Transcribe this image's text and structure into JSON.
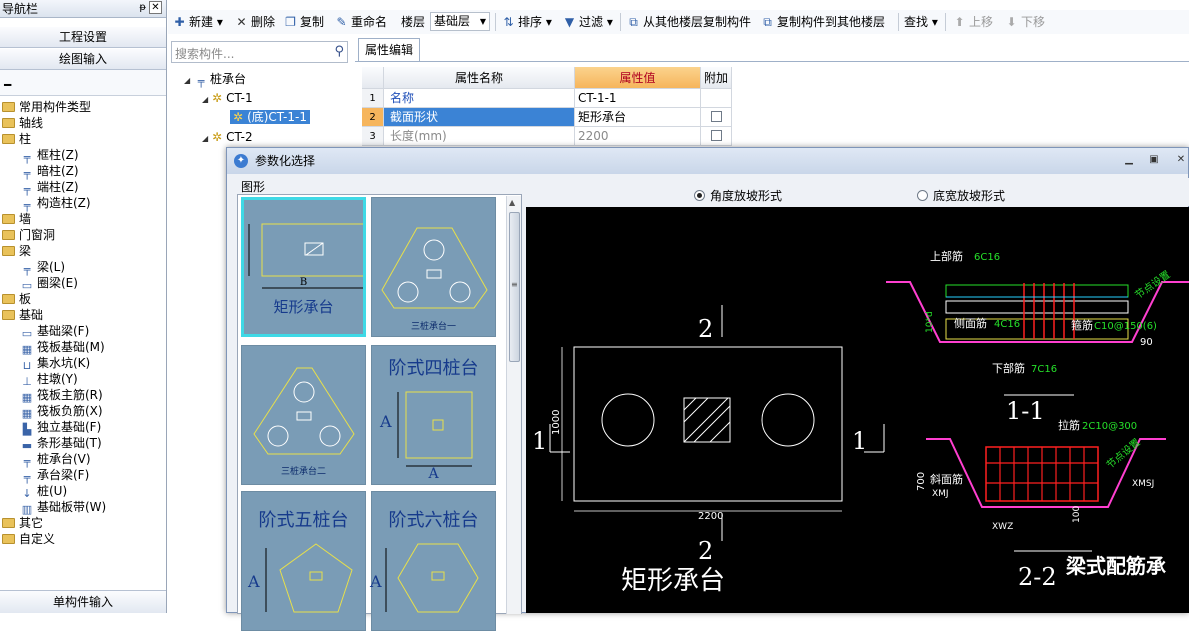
{
  "nav": {
    "title": "导航栏",
    "pin": "ᵽ",
    "close": "✕",
    "btn_settings": "工程设置",
    "btn_draw": "绘图输入",
    "bottom": "单构件输入",
    "groups": [
      {
        "label": "常用构件类型"
      },
      {
        "label": "轴线"
      },
      {
        "label": "柱"
      },
      {
        "label": "墙"
      },
      {
        "label": "门窗洞"
      },
      {
        "label": "梁"
      },
      {
        "label": "板"
      },
      {
        "label": "基础"
      },
      {
        "label": "其它"
      },
      {
        "label": "自定义"
      }
    ],
    "items": {
      "kz": "框柱(Z)",
      "az": "暗柱(Z)",
      "dz": "端柱(Z)",
      "gzz": "构造柱(Z)",
      "liang": "梁(L)",
      "ql": "圈梁(E)",
      "jcl": "基础梁(F)",
      "fbjc": "筏板基础(M)",
      "jsk": "集水坑(K)",
      "zd": "柱墩(Y)",
      "fbzj": "筏板主筋(R)",
      "fbfj": "筏板负筋(X)",
      "dljc": "独立基础(F)",
      "txjc": "条形基础(T)",
      "zct": "桩承台(V)",
      "ctl": "承台梁(F)",
      "zhuang": "桩(U)",
      "jcbd": "基础板带(W)"
    }
  },
  "toolbar": {
    "new": "新建",
    "delete": "删除",
    "copy": "复制",
    "rename": "重命名",
    "floor_label": "楼层",
    "floor_value": "基础层",
    "sort": "排序",
    "filter": "过滤",
    "copy_from": "从其他楼层复制构件",
    "copy_to": "复制构件到其他楼层",
    "find": "查找",
    "up": "上移",
    "down": "下移"
  },
  "search": {
    "placeholder": "搜索构件..."
  },
  "tree": {
    "root": "桩承台",
    "ct1": "CT-1",
    "ct11": "(底)CT-1-1",
    "ct2": "CT-2"
  },
  "props": {
    "tab": "属性编辑",
    "col_name": "属性名称",
    "col_value": "属性值",
    "col_attach": "附加",
    "rows": [
      {
        "n": "1",
        "name": "名称",
        "value": "CT-1-1"
      },
      {
        "n": "2",
        "name": "截面形状",
        "value": "矩形承台"
      },
      {
        "n": "3",
        "name": "长度(mm)",
        "value": "2200"
      }
    ]
  },
  "dialog": {
    "title": "参数化选择",
    "shape_label": "图形",
    "radio1": "角度放坡形式",
    "radio2": "底宽放坡形式",
    "thumbs": {
      "t1": "矩形承台",
      "t2": "三桩承台一",
      "t3": "三桩承台二",
      "t4": "阶式四桩台",
      "t5": "阶式五桩台",
      "t6": "阶式六桩台",
      "b": "B",
      "a": "A"
    }
  },
  "drawing": {
    "main_title": "矩形承台",
    "sec2": "2",
    "sec1": "1",
    "dim_w": "2200",
    "dim_h": "1000",
    "s11": "1-1",
    "s22": "2-2",
    "beam_title": "梁式配筋承",
    "top_bar": "上部筋",
    "top_val": "6C16",
    "side_bar": "侧面筋",
    "side_val": "4C16",
    "stirrup": "箍筋",
    "stirrup_val": "C10@150(6)",
    "bottom_bar": "下部筋",
    "bottom_val": "7C16",
    "angle": "90",
    "node": "节点设置",
    "tie": "拉筋",
    "tie_val": "2C10@300",
    "slope": "斜面筋",
    "xmj": "XMJ",
    "xmsj": "XMSJ",
    "xwz": "XWZ",
    "h700": "700",
    "h100": "100",
    "t10d": "10*d"
  },
  "colors": {
    "accent": "#3b83d5",
    "canvas": "#000000",
    "header_value": "#f6b55c"
  }
}
